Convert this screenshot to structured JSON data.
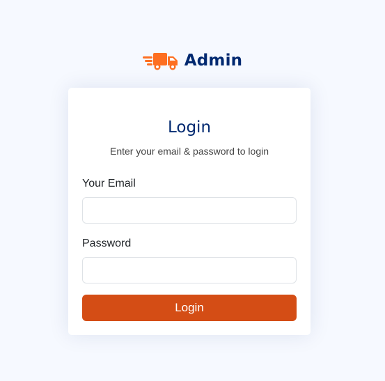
{
  "brand": {
    "name": "Admin",
    "icon": "delivery-truck-icon",
    "icon_color": "#fd6f21",
    "name_color": "#012970"
  },
  "login_card": {
    "title": "Login",
    "subtitle": "Enter your email & password to login",
    "email_label": "Your Email",
    "email_value": "",
    "password_label": "Password",
    "password_value": "",
    "submit_label": "Login",
    "submit_color": "#d44d15"
  }
}
